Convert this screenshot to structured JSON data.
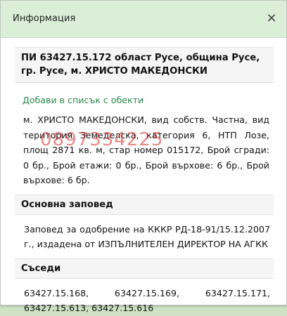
{
  "dialog": {
    "title": "Информация",
    "close_icon": "close-icon",
    "close_label": "×"
  },
  "parcel": {
    "heading": "ПИ 63427.15.172 област Русе, община Русе, гр. Русе, м. ХРИСТО МАКЕДОНСКИ",
    "add_link": "Добави в списък с обекти",
    "description": "м. ХРИСТО МАКЕДОНСКИ, вид собств. Частна, вид територия Земеделска, категория 6, НТП Лозе, площ 2871 кв. м, стар номер 015172, Брой сгради: 0 бр., Брой етажи: 0 бр., Брой върхове: 6 бр., Брой върхове: 6 бр.",
    "watermark": "0897334225"
  },
  "sections": [
    {
      "title": "Основна заповед",
      "body": "Заповед за одобрение на КККР РД-18-91/15.12.2007 г., издадена от ИЗПЪЛНИТЕЛЕН ДИРЕКТОР НА АГКК"
    },
    {
      "title": "Съседи",
      "body": "63427.15.168, 63427.15.169, 63427.15.171, 63427.15.613, 63427.15.616"
    }
  ]
}
